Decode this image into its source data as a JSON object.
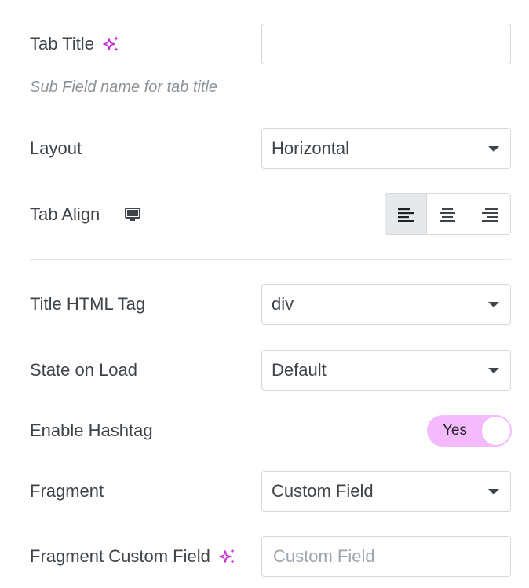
{
  "tab_title": {
    "label": "Tab Title",
    "value": "",
    "hint": "Sub Field name for tab title"
  },
  "layout": {
    "label": "Layout",
    "value": "Horizontal"
  },
  "tab_align": {
    "label": "Tab Align",
    "options": [
      "left",
      "center",
      "right"
    ],
    "selected": "left"
  },
  "title_html_tag": {
    "label": "Title HTML Tag",
    "value": "div"
  },
  "state_on_load": {
    "label": "State on Load",
    "value": "Default"
  },
  "enable_hashtag": {
    "label": "Enable Hashtag",
    "toggle_text": "Yes",
    "on": true
  },
  "fragment": {
    "label": "Fragment",
    "value": "Custom Field"
  },
  "fragment_custom_field": {
    "label": "Fragment Custom Field",
    "placeholder": "Custom Field"
  },
  "colors": {
    "accent": "#c32bd1",
    "toggle_bg": "#f3bafd",
    "text": "#3f444b",
    "border": "#d5d8dc"
  },
  "icons": {
    "ai": "sparkles-icon",
    "device": "desktop-monitor-icon"
  }
}
